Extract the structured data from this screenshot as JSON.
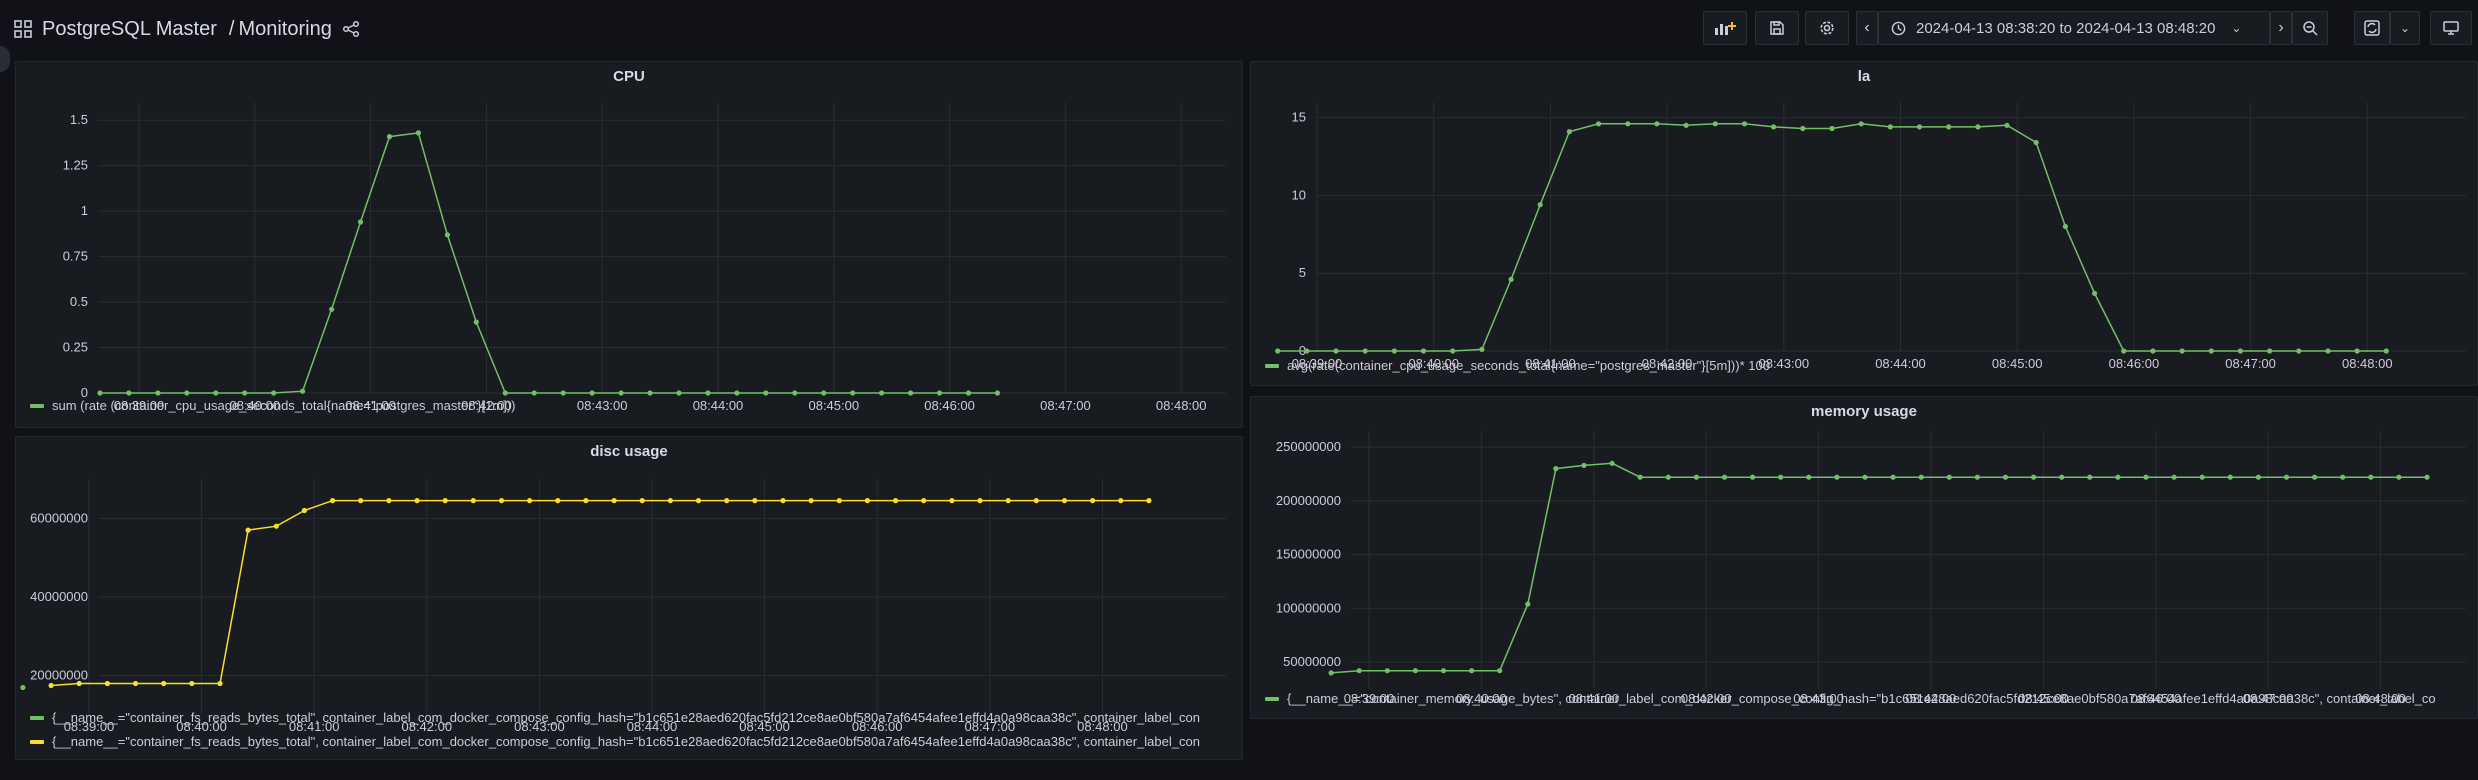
{
  "header": {
    "app_title": "PostgreSQL Master",
    "separator": "/",
    "page": "Monitoring",
    "time_range": "2024-04-13 08:38:20 to 2024-04-13 08:48:20",
    "icons": [
      "apps-icon",
      "share-icon",
      "add-panel-icon",
      "save-icon",
      "settings-icon",
      "chevron-left-icon",
      "clock-icon",
      "chevron-down-icon",
      "chevron-right-icon",
      "zoom-out-icon",
      "refresh-icon",
      "chevron-down-icon",
      "tv-mode-icon"
    ]
  },
  "colors": {
    "green": "#73bf69",
    "yellow": "#fade2a",
    "grid": "#2a2d33",
    "bg": "#181b1f"
  },
  "panels": {
    "cpu": {
      "title": "CPU",
      "legend": [
        "sum (rate (container_cpu_usage_seconds_total{name=\"postgres_master\"}[1m]))"
      ]
    },
    "la": {
      "title": "la",
      "legend": [
        "avg(rate(container_cpu_usage_seconds_total{name=\"postgres_master\"}[5m]))* 100"
      ]
    },
    "disc": {
      "title": "disc usage",
      "legend": [
        "{__name__=\"container_fs_reads_bytes_total\", container_label_com_docker_compose_config_hash=\"b1c651e28aed620fac5fd212ce8ae0bf580a7af6454afee1effd4a0a98caa38c\", container_label_con",
        "{__name__=\"container_fs_reads_bytes_total\", container_label_com_docker_compose_config_hash=\"b1c651e28aed620fac5fd212ce8ae0bf580a7af6454afee1effd4a0a98caa38c\", container_label_con"
      ]
    },
    "memory": {
      "title": "memory usage",
      "legend": [
        "{__name__=\"container_memory_usage_bytes\", container_label_com_docker_compose_config_hash=\"b1c651e28aed620fac5fd212ce8ae0bf580a7af6454afee1effd4a0a98caa38c\", container_label_co"
      ]
    }
  },
  "chart_data": [
    {
      "type": "line",
      "title": "CPU",
      "x_ticks": [
        "08:39:00",
        "08:40:00",
        "08:41:00",
        "08:42:00",
        "08:43:00",
        "08:44:00",
        "08:45:00",
        "08:46:00",
        "08:47:00",
        "08:48:00"
      ],
      "x_range_minutes": [
        0,
        10
      ],
      "y_ticks": [
        "0",
        "0.25",
        "0.5",
        "0.75",
        "1",
        "1.25",
        "1.5"
      ],
      "ylim": [
        0,
        1.6
      ],
      "series": [
        {
          "color": "#73bf69",
          "x": [
            0.33,
            0.58,
            0.83,
            1.08,
            1.33,
            1.58,
            1.83,
            2.08,
            2.33,
            2.58,
            2.83,
            3.08,
            3.33,
            3.58,
            3.83,
            4.08,
            4.33,
            4.58,
            4.83,
            5.08,
            5.33,
            5.58,
            5.83,
            6.08,
            6.33,
            6.58,
            6.83,
            7.08,
            7.33,
            7.58,
            7.83,
            8.08
          ],
          "y": [
            0,
            0,
            0,
            0,
            0,
            0,
            0,
            0.01,
            0.46,
            0.94,
            1.41,
            1.43,
            0.87,
            0.39,
            0,
            0,
            0,
            0,
            0,
            0,
            0,
            0,
            0,
            0,
            0,
            0,
            0,
            0,
            0,
            0,
            0,
            0
          ]
        }
      ]
    },
    {
      "type": "line",
      "title": "la",
      "x_ticks": [
        "08:39:00",
        "08:40:00",
        "08:41:00",
        "08:42:00",
        "08:43:00",
        "08:44:00",
        "08:45:00",
        "08:46:00",
        "08:47:00",
        "08:48:00"
      ],
      "x_range_minutes": [
        0,
        10
      ],
      "y_ticks": [
        "0",
        "5",
        "10",
        "15"
      ],
      "ylim": [
        0,
        16
      ],
      "series": [
        {
          "color": "#73bf69",
          "x": [
            0.33,
            0.58,
            0.83,
            1.08,
            1.33,
            1.58,
            1.83,
            2.08,
            2.33,
            2.58,
            2.83,
            3.08,
            3.33,
            3.58,
            3.83,
            4.08,
            4.33,
            4.58,
            4.83,
            5.08,
            5.33,
            5.58,
            5.83,
            6.08,
            6.33,
            6.58,
            6.83,
            7.08,
            7.33,
            7.58,
            7.83,
            8.08,
            8.33,
            8.58,
            8.83,
            9.08,
            9.33,
            9.58,
            9.83
          ],
          "y": [
            0,
            0,
            0,
            0,
            0,
            0,
            0,
            0.1,
            4.6,
            9.4,
            14.1,
            14.6,
            14.6,
            14.6,
            14.5,
            14.6,
            14.6,
            14.4,
            14.3,
            14.3,
            14.6,
            14.4,
            14.4,
            14.4,
            14.4,
            14.5,
            13.4,
            8.0,
            3.7,
            0,
            0,
            0,
            0,
            0,
            0,
            0,
            0,
            0,
            0
          ]
        }
      ]
    },
    {
      "type": "line",
      "title": "disc usage",
      "x_ticks": [
        "08:39:00",
        "08:40:00",
        "08:41:00",
        "08:42:00",
        "08:43:00",
        "08:44:00",
        "08:45:00",
        "08:46:00",
        "08:47:00",
        "08:48:00"
      ],
      "x_range_minutes": [
        0,
        10
      ],
      "y_ticks": [
        "20000000",
        "40000000",
        "60000000"
      ],
      "ylim": [
        10000000,
        70000000
      ],
      "series": [
        {
          "color": "#73bf69",
          "x": [
            0.08
          ],
          "y": [
            17000000
          ]
        },
        {
          "color": "#fade2a",
          "x": [
            0.33,
            0.58,
            0.83,
            1.08,
            1.33,
            1.58,
            1.83,
            2.08,
            2.33,
            2.58,
            2.83,
            3.08,
            3.33,
            3.58,
            3.83,
            4.08,
            4.33,
            4.58,
            4.83,
            5.08,
            5.33,
            5.58,
            5.83,
            6.08,
            6.33,
            6.58,
            6.83,
            7.08,
            7.33,
            7.58,
            7.83,
            8.08,
            8.33,
            8.58,
            8.83,
            9.08,
            9.33,
            9.58,
            9.83,
            10.08
          ],
          "y": [
            17500000,
            18000000,
            18000000,
            18000000,
            18000000,
            18000000,
            18000000,
            57000000,
            58000000,
            62000000,
            64500000,
            64500000,
            64500000,
            64500000,
            64500000,
            64500000,
            64500000,
            64500000,
            64500000,
            64500000,
            64500000,
            64500000,
            64500000,
            64500000,
            64500000,
            64500000,
            64500000,
            64500000,
            64500000,
            64500000,
            64500000,
            64500000,
            64500000,
            64500000,
            64500000,
            64500000,
            64500000,
            64500000,
            64500000,
            64500000
          ]
        }
      ]
    },
    {
      "type": "line",
      "title": "memory usage",
      "x_ticks": [
        "08:39:00",
        "08:40:00",
        "08:41:00",
        "08:42:00",
        "08:43:00",
        "08:44:00",
        "08:45:00",
        "08:46:00",
        "08:47:00",
        "08:48:00"
      ],
      "x_range_minutes": [
        0,
        10
      ],
      "y_ticks": [
        "50000000",
        "100000000",
        "150000000",
        "200000000",
        "250000000"
      ],
      "ylim": [
        25000000,
        265000000
      ],
      "series": [
        {
          "color": "#73bf69",
          "x": [
            0.33,
            0.58,
            0.83,
            1.08,
            1.33,
            1.58,
            1.83,
            2.08,
            2.33,
            2.58,
            2.83,
            3.08,
            3.33,
            3.58,
            3.83,
            4.08,
            4.33,
            4.58,
            4.83,
            5.08,
            5.33,
            5.58,
            5.83,
            6.08,
            6.33,
            6.58,
            6.83,
            7.08,
            7.33,
            7.58,
            7.83,
            8.08,
            8.33,
            8.58,
            8.83,
            9.08,
            9.33,
            9.58,
            9.83,
            10.08
          ],
          "y": [
            40000000,
            42000000,
            42000000,
            42000000,
            42000000,
            42000000,
            42000000,
            104000000,
            230000000,
            233000000,
            235000000,
            222000000,
            222000000,
            222000000,
            222000000,
            222000000,
            222000000,
            222000000,
            222000000,
            222000000,
            222000000,
            222000000,
            222000000,
            222000000,
            222000000,
            222000000,
            222000000,
            222000000,
            222000000,
            222000000,
            222000000,
            222000000,
            222000000,
            222000000,
            222000000,
            222000000,
            222000000,
            222000000,
            222000000,
            222000000
          ]
        }
      ]
    }
  ]
}
